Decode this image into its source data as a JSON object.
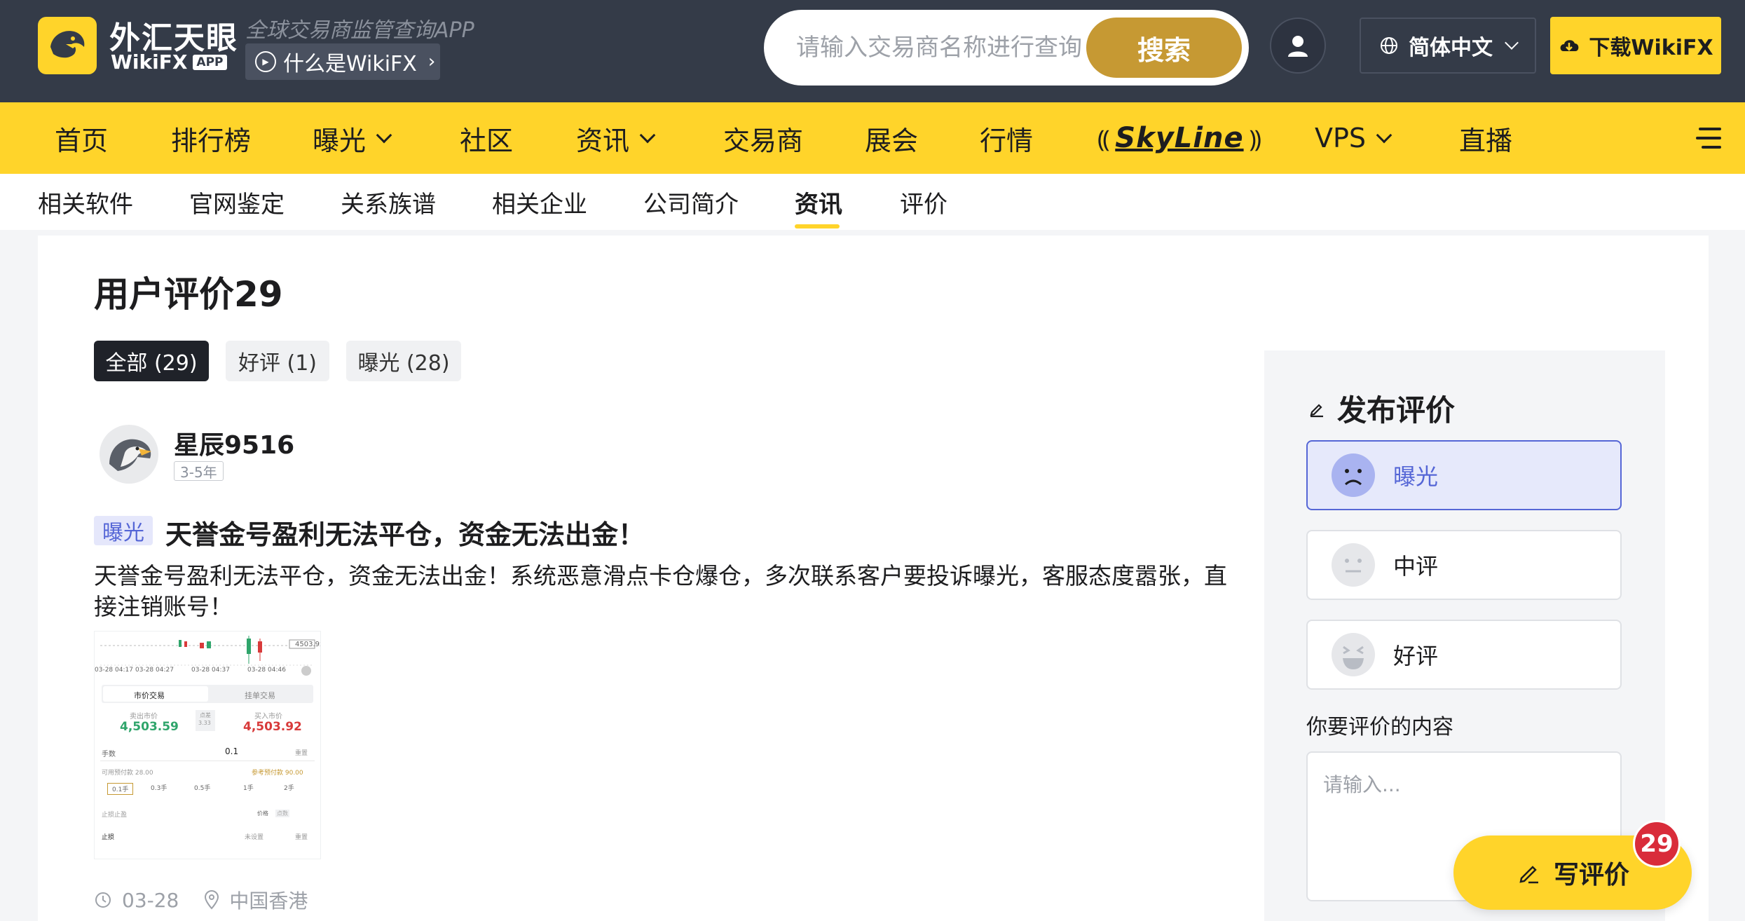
{
  "header": {
    "logo_cn": "外汇天眼",
    "logo_en": "WikiFX",
    "logo_app_tag": "APP",
    "slogan": "全球交易商监管查询APP",
    "what_label": "什么是WikiFX",
    "search_placeholder": "请输入交易商名称进行查询",
    "search_button": "搜索",
    "language": "简体中文",
    "download": "下载WikiFX"
  },
  "main_nav": {
    "items": [
      "首页",
      "排行榜",
      "曝光",
      "社区",
      "资讯",
      "交易商",
      "展会",
      "行情",
      "SkyLine",
      "VPS",
      "直播"
    ]
  },
  "sub_nav": {
    "items": [
      "相关软件",
      "官网鉴定",
      "关系族谱",
      "相关企业",
      "公司简介",
      "资讯",
      "评价"
    ],
    "active": "资讯"
  },
  "reviews": {
    "title": "用户评价29",
    "filters": [
      "全部 (29)",
      "好评 (1)",
      "曝光 (28)"
    ],
    "post": {
      "username": "星辰9516",
      "years": "3-5年",
      "tag": "曝光",
      "title": "天誉金号盈利无法平仓，资金无法出金！",
      "body": "天誉金号盈利无法平仓，资金无法出金！系统恶意滑点卡仓爆仓，多次联系客户要投诉曝光，客服态度嚣张，直接注销账号！",
      "date": "03-28",
      "location": "中国香港",
      "screenshot": {
        "times": [
          "03-28 04:17",
          "03-28 04:27",
          "03-28 04:37",
          "03-28 04:46"
        ],
        "price_tag": "4503.9x",
        "tab_market": "市价交易",
        "tab_pending": "挂单交易",
        "sell_label": "卖出市价",
        "sell_price": "4,503.59",
        "spread_label": "点差",
        "spread": "3.33",
        "buy_label": "买入市价",
        "buy_price": "4,503.92",
        "lots_label": "手数",
        "lots": "0.1",
        "reset": "重置",
        "margin_label": "可用预付款 28.00",
        "ref_label": "参考预付款 90.00",
        "quick_lots": [
          "0.1手",
          "0.3手",
          "0.5手",
          "1手",
          "2手"
        ],
        "tp_sl": "止损止盈",
        "price_mode": "价格",
        "points_mode": "点数",
        "stop_loss": "止损",
        "unset": "未设置"
      }
    }
  },
  "sidebar": {
    "title": "发布评价",
    "options": [
      {
        "label": "曝光",
        "selected": true
      },
      {
        "label": "中评",
        "selected": false
      },
      {
        "label": "好评",
        "selected": false
      }
    ],
    "content_label": "你要评价的内容",
    "content_placeholder": "请输入..."
  },
  "write_review": {
    "label": "写评价",
    "count": "29"
  },
  "colors": {
    "header_bg": "#343b48",
    "brand_yellow": "#ffd42a",
    "search_gold": "#c69933",
    "expose_blue": "#5566d6",
    "badge_red": "#d92c3a"
  }
}
